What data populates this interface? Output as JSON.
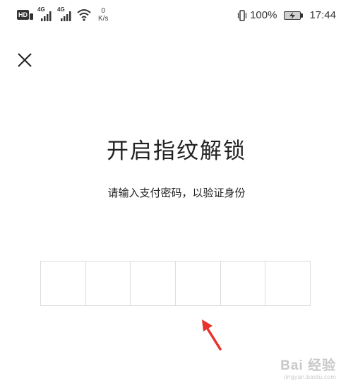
{
  "status_bar": {
    "hd_label": "HD",
    "signal_1_label": "4G",
    "signal_2_label": "4G",
    "speed_value": "0",
    "speed_unit": "K/s",
    "battery_percent": "100%",
    "time": "17:44"
  },
  "header": {
    "close_icon": "close-icon"
  },
  "main": {
    "title": "开启指纹解锁",
    "subtitle": "请输入支付密码，以验证身份",
    "pin_cells": 6
  },
  "colors": {
    "arrow": "#e8312a",
    "pin_border": "#dcdcdc",
    "text": "#222222"
  },
  "watermark": {
    "main": "Bai 经验",
    "sub": "jingyan.baidu.com"
  }
}
